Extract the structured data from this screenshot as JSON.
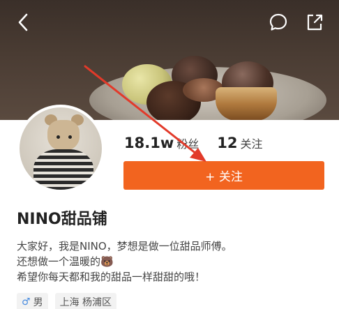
{
  "header": {
    "back_icon": "chevron-left-icon",
    "message_icon": "chat-bubble-icon",
    "share_icon": "share-out-icon"
  },
  "profile": {
    "followers_count": "18.1w",
    "followers_label": "粉丝",
    "following_count": "12",
    "following_label": "关注",
    "follow_button_label": "+ 关注",
    "name": "NINO甜品铺",
    "bio": [
      "大家好，我是NINO，梦想是做一位甜品师傅。",
      "还想做一个温暖的🐻",
      "希望你每天都和我的甜品一样甜甜的哦！"
    ],
    "gender_icon": "male-symbol-icon",
    "gender": "男",
    "location": "上海 杨浦区"
  },
  "colors": {
    "accent": "#f2641f",
    "annotation_arrow": "#e23a2a"
  }
}
